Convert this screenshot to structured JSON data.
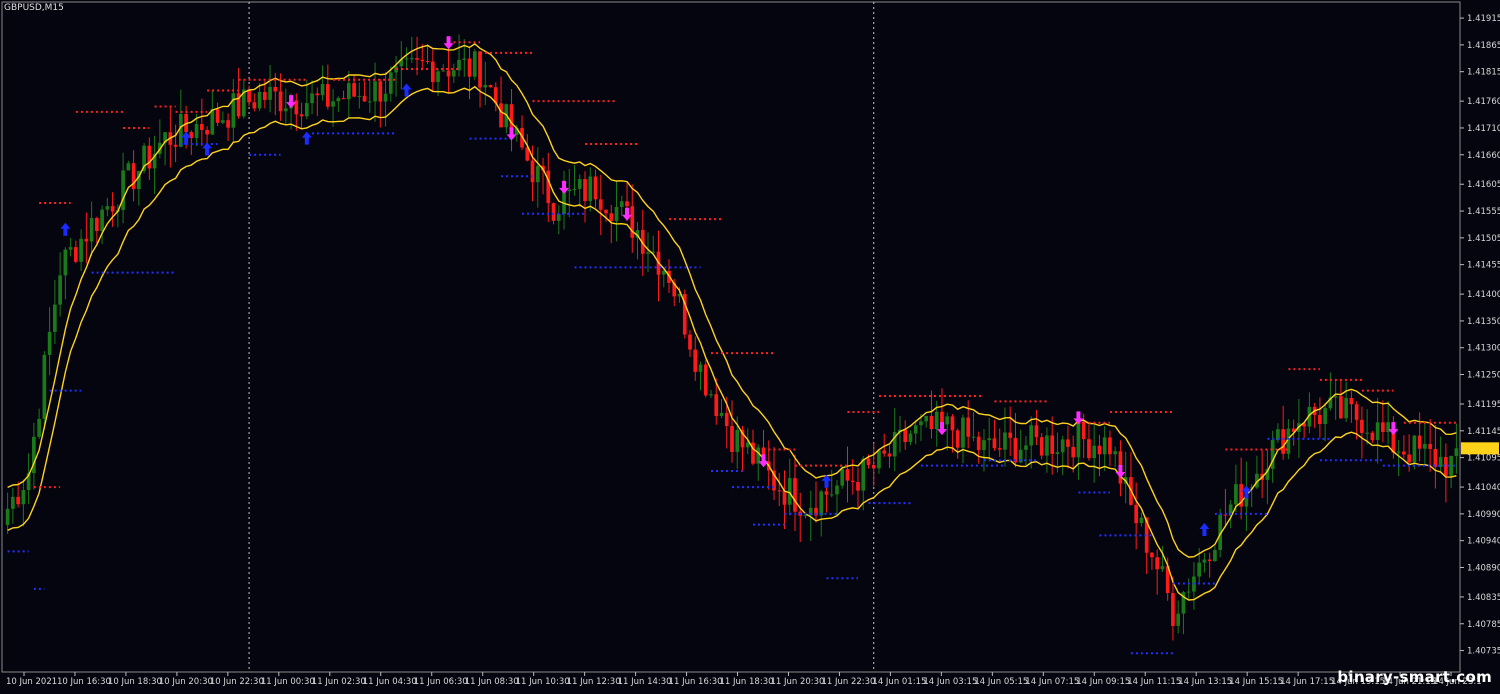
{
  "symbol_title": "GBPUSD,M15",
  "watermark": "binary-smart.com",
  "colors": {
    "background": "#05050f",
    "bull_candle": "#1a7a1a",
    "bear_candle": "#ff1a1a",
    "band": "#ffd21a",
    "resistance_dots": "#ff2020",
    "support_dots": "#2030ff",
    "up_arrow": "#1a2cff",
    "down_arrow": "#ff2cff",
    "axis_text": "#d8d8d8",
    "separator": "#c8c8c8"
  },
  "chart_data": {
    "type": "candlestick",
    "title": "GBPUSD,M15",
    "ylim": [
      1.40695,
      1.41945
    ],
    "y_ticks": [
      "1.41915",
      "1.41865",
      "1.41815",
      "1.41760",
      "1.41710",
      "1.41660",
      "1.41605",
      "1.41555",
      "1.41505",
      "1.41455",
      "1.41400",
      "1.41350",
      "1.41300",
      "1.41250",
      "1.41195",
      "1.41145",
      "1.41095",
      "1.41040",
      "1.40990",
      "1.40940",
      "1.40890",
      "1.40835",
      "1.40785",
      "1.40735"
    ],
    "x_tick_labels": [
      "10 Jun 2021",
      "10 Jun 16:30",
      "10 Jun 18:30",
      "10 Jun 20:30",
      "10 Jun 22:30",
      "11 Jun 00:30",
      "11 Jun 02:30",
      "11 Jun 04:30",
      "11 Jun 06:30",
      "11 Jun 08:30",
      "11 Jun 10:30",
      "11 Jun 12:30",
      "11 Jun 14:30",
      "11 Jun 16:30",
      "11 Jun 18:30",
      "11 Jun 20:30",
      "11 Jun 22:30",
      "14 Jun 01:15",
      "14 Jun 03:15",
      "14 Jun 05:15",
      "14 Jun 07:15",
      "14 Jun 09:15",
      "14 Jun 11:15",
      "14 Jun 13:15",
      "14 Jun 15:15",
      "14 Jun 17:15",
      "14 Jun 19:15",
      "14 Jun 21:15",
      "14 Jun 23:1"
    ],
    "separators": [
      "11 Jun 00:00",
      "14 Jun 00:00"
    ],
    "indicators": [
      "upper band",
      "lower band",
      "resistance levels",
      "support levels",
      "buy arrows",
      "sell arrows"
    ],
    "anchors": [
      {
        "i": 0,
        "p": 1.41
      },
      {
        "i": 4,
        "p": 1.4107
      },
      {
        "i": 10,
        "p": 1.4145
      },
      {
        "i": 16,
        "p": 1.4153
      },
      {
        "i": 22,
        "p": 1.416
      },
      {
        "i": 30,
        "p": 1.4169
      },
      {
        "i": 40,
        "p": 1.4173
      },
      {
        "i": 48,
        "p": 1.4177
      },
      {
        "i": 60,
        "p": 1.4176
      },
      {
        "i": 70,
        "p": 1.4178
      },
      {
        "i": 80,
        "p": 1.4183
      },
      {
        "i": 90,
        "p": 1.4182
      },
      {
        "i": 96,
        "p": 1.417
      },
      {
        "i": 104,
        "p": 1.4157
      },
      {
        "i": 112,
        "p": 1.416
      },
      {
        "i": 120,
        "p": 1.4152
      },
      {
        "i": 126,
        "p": 1.4144
      },
      {
        "i": 132,
        "p": 1.4126
      },
      {
        "i": 138,
        "p": 1.4114
      },
      {
        "i": 146,
        "p": 1.4105
      },
      {
        "i": 152,
        "p": 1.4101
      },
      {
        "i": 160,
        "p": 1.4105
      },
      {
        "i": 166,
        "p": 1.4108
      },
      {
        "i": 172,
        "p": 1.4114
      },
      {
        "i": 180,
        "p": 1.4115
      },
      {
        "i": 186,
        "p": 1.4111
      },
      {
        "i": 194,
        "p": 1.4112
      },
      {
        "i": 204,
        "p": 1.4113
      },
      {
        "i": 210,
        "p": 1.4112
      },
      {
        "i": 214,
        "p": 1.41
      },
      {
        "i": 218,
        "p": 1.4092
      },
      {
        "i": 222,
        "p": 1.4081
      },
      {
        "i": 226,
        "p": 1.4088
      },
      {
        "i": 232,
        "p": 1.4099
      },
      {
        "i": 240,
        "p": 1.411
      },
      {
        "i": 246,
        "p": 1.4117
      },
      {
        "i": 252,
        "p": 1.4118
      },
      {
        "i": 258,
        "p": 1.4117
      },
      {
        "i": 264,
        "p": 1.4112
      },
      {
        "i": 270,
        "p": 1.411
      },
      {
        "i": 276,
        "p": 1.4108
      }
    ],
    "bar_count": 277,
    "resistance_levels": [
      {
        "from": 5,
        "to": 10,
        "p": 1.4104
      },
      {
        "from": 6,
        "to": 12,
        "p": 1.4157
      },
      {
        "from": 13,
        "to": 22,
        "p": 1.4174
      },
      {
        "from": 22,
        "to": 27,
        "p": 1.4171
      },
      {
        "from": 28,
        "to": 32,
        "p": 1.4175
      },
      {
        "from": 32,
        "to": 38,
        "p": 1.4174
      },
      {
        "from": 38,
        "to": 44,
        "p": 1.4178
      },
      {
        "from": 44,
        "to": 57,
        "p": 1.418
      },
      {
        "from": 62,
        "to": 74,
        "p": 1.418
      },
      {
        "from": 74,
        "to": 86,
        "p": 1.4182
      },
      {
        "from": 84,
        "to": 90,
        "p": 1.4187
      },
      {
        "from": 90,
        "to": 100,
        "p": 1.4185
      },
      {
        "from": 100,
        "to": 116,
        "p": 1.4176
      },
      {
        "from": 110,
        "to": 120,
        "p": 1.4168
      },
      {
        "from": 126,
        "to": 136,
        "p": 1.4154
      },
      {
        "from": 134,
        "to": 146,
        "p": 1.4129
      },
      {
        "from": 144,
        "to": 150,
        "p": 1.4111
      },
      {
        "from": 150,
        "to": 160,
        "p": 1.4108
      },
      {
        "from": 160,
        "to": 166,
        "p": 1.4118
      },
      {
        "from": 166,
        "to": 186,
        "p": 1.4121
      },
      {
        "from": 188,
        "to": 198,
        "p": 1.412
      },
      {
        "from": 204,
        "to": 210,
        "p": 1.4116
      },
      {
        "from": 210,
        "to": 222,
        "p": 1.4118
      },
      {
        "from": 232,
        "to": 244,
        "p": 1.4111
      },
      {
        "from": 244,
        "to": 250,
        "p": 1.4126
      },
      {
        "from": 250,
        "to": 258,
        "p": 1.4124
      },
      {
        "from": 258,
        "to": 264,
        "p": 1.4122
      },
      {
        "from": 266,
        "to": 276,
        "p": 1.4116
      }
    ],
    "support_levels": [
      {
        "from": 0,
        "to": 4,
        "p": 1.4092
      },
      {
        "from": 5,
        "to": 7,
        "p": 1.4085
      },
      {
        "from": 8,
        "to": 14,
        "p": 1.4122
      },
      {
        "from": 16,
        "to": 32,
        "p": 1.4144
      },
      {
        "from": 33,
        "to": 40,
        "p": 1.4168
      },
      {
        "from": 46,
        "to": 52,
        "p": 1.4166
      },
      {
        "from": 58,
        "to": 74,
        "p": 1.417
      },
      {
        "from": 88,
        "to": 96,
        "p": 1.4169
      },
      {
        "from": 94,
        "to": 100,
        "p": 1.4162
      },
      {
        "from": 98,
        "to": 110,
        "p": 1.4155
      },
      {
        "from": 108,
        "to": 132,
        "p": 1.4145
      },
      {
        "from": 134,
        "to": 140,
        "p": 1.4107
      },
      {
        "from": 138,
        "to": 146,
        "p": 1.4104
      },
      {
        "from": 142,
        "to": 148,
        "p": 1.4097
      },
      {
        "from": 148,
        "to": 158,
        "p": 1.4099
      },
      {
        "from": 156,
        "to": 162,
        "p": 1.4087
      },
      {
        "from": 164,
        "to": 172,
        "p": 1.4101
      },
      {
        "from": 174,
        "to": 190,
        "p": 1.4108
      },
      {
        "from": 186,
        "to": 196,
        "p": 1.4109
      },
      {
        "from": 204,
        "to": 210,
        "p": 1.4103
      },
      {
        "from": 208,
        "to": 218,
        "p": 1.4095
      },
      {
        "from": 214,
        "to": 222,
        "p": 1.4073
      },
      {
        "from": 222,
        "to": 230,
        "p": 1.4086
      },
      {
        "from": 230,
        "to": 240,
        "p": 1.4099
      },
      {
        "from": 240,
        "to": 252,
        "p": 1.4113
      },
      {
        "from": 250,
        "to": 262,
        "p": 1.4109
      },
      {
        "from": 262,
        "to": 276,
        "p": 1.4108
      }
    ],
    "buy_signals": [
      {
        "i": 11,
        "p": 1.4152
      },
      {
        "i": 34,
        "p": 1.4169
      },
      {
        "i": 38,
        "p": 1.4167
      },
      {
        "i": 57,
        "p": 1.4169
      },
      {
        "i": 76,
        "p": 1.4178
      },
      {
        "i": 156,
        "p": 1.4105
      },
      {
        "i": 228,
        "p": 1.4096
      },
      {
        "i": 236,
        "p": 1.4103
      }
    ],
    "sell_signals": [
      {
        "i": 54,
        "p": 1.4176
      },
      {
        "i": 84,
        "p": 1.4187
      },
      {
        "i": 96,
        "p": 1.417
      },
      {
        "i": 106,
        "p": 1.416
      },
      {
        "i": 118,
        "p": 1.4155
      },
      {
        "i": 144,
        "p": 1.4109
      },
      {
        "i": 178,
        "p": 1.4115
      },
      {
        "i": 204,
        "p": 1.4117
      },
      {
        "i": 212,
        "p": 1.4107
      },
      {
        "i": 264,
        "p": 1.4115
      }
    ]
  }
}
